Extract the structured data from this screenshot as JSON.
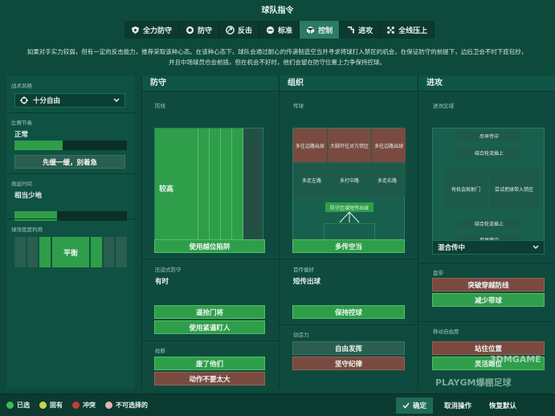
{
  "header": {
    "title": "球队指令",
    "tabs": [
      {
        "label": "全力防守",
        "icon": "shield-star-icon",
        "active": false
      },
      {
        "label": "防守",
        "icon": "shield-icon",
        "active": false
      },
      {
        "label": "反击",
        "icon": "counter-arrow-icon",
        "active": false
      },
      {
        "label": "标准",
        "icon": "balance-icon",
        "active": false
      },
      {
        "label": "控制",
        "icon": "control-cube-icon",
        "active": true
      },
      {
        "label": "进攻",
        "icon": "attack-arrow-icon",
        "active": false
      },
      {
        "label": "全线压上",
        "icon": "press-icon",
        "active": false
      }
    ],
    "description_line1": "如果对手实力较弱，但有一定的反击能力，推荐采取该种心态。在该种心态下，球队会通过耐心的传递制造空当并寻求将球打入禁区的机会，在保证防守的前提下，边后卫会不时下底包抄，",
    "description_line2": "并且中场球员也会前插，但在机会不好时，他们会留在防守位置上力争保持控球。"
  },
  "left": {
    "style_label": "战术风格",
    "style_value": "十分自由",
    "tempo_label": "比赛节奏",
    "tempo_value": "正常",
    "tempo_level": 0.43,
    "tempo_button": "先缓一缓，别着急",
    "timewasting_label": "拖延时间",
    "timewasting_value": "相当少地",
    "timewasting_level": 0.38,
    "width_label": "球场宽度利用",
    "width_value": "平衡"
  },
  "defense": {
    "title": "防守",
    "line_label": "防线",
    "line_value": "较高",
    "offside_button": "使用越位陷阱",
    "press_label": "压迫式防守",
    "press_value": "有时",
    "press_level": 0.6,
    "press_buttons": [
      "逼抢门将",
      "使用紧逼盯人"
    ],
    "tackle_label": "抢断",
    "tackle_buttons": [
      "废了他们",
      "动作不要太大"
    ]
  },
  "organize": {
    "title": "组织",
    "pass_label": "传球",
    "pitch_cells": [
      "多往边路出球",
      "大脚开往对方禁区",
      "多往边路出球",
      "多走左路",
      "多打中路",
      "多走右路"
    ],
    "gk_label": "防守区域短传出球",
    "short_button": "多传空当",
    "pref_label": "首传偏好",
    "pref_value": "短传出球",
    "keep_button": "保持控球",
    "creative_label": "创造力",
    "creative_buttons": [
      "自由发挥",
      "坚守纪律"
    ]
  },
  "attack": {
    "title": "进攻",
    "zone_label": "进攻区域",
    "zone_cells": [
      "尽早传中",
      "结合轮流插上",
      "有机会就射门",
      "尝试把球带入禁区",
      "结合轮流插上",
      "尽早传中"
    ],
    "cross_select": "混合传中",
    "dribble_label": "盘带",
    "dribble_buttons": [
      "突破穿越防线",
      "减少带球"
    ],
    "move_label": "移动自由度",
    "move_buttons": [
      "站住位置",
      "灵活跑位"
    ]
  },
  "footer": {
    "legend": [
      {
        "label": "已选",
        "color": "#3dbb53"
      },
      {
        "label": "固有",
        "color": "#c7d84a"
      },
      {
        "label": "冲突",
        "color": "#c43a3a"
      },
      {
        "label": "不可选择的",
        "color": "#e6b3b3"
      }
    ],
    "confirm": "确定",
    "cancel": "取消操作",
    "restore": "恢复默认",
    "watermark": "PLAYGM爆棚足球",
    "watermark2": "3DMGAME"
  },
  "colors": {
    "selected": "#2f9e4a",
    "bg": "#0d4a3c",
    "conflict": "#7a4a40"
  }
}
